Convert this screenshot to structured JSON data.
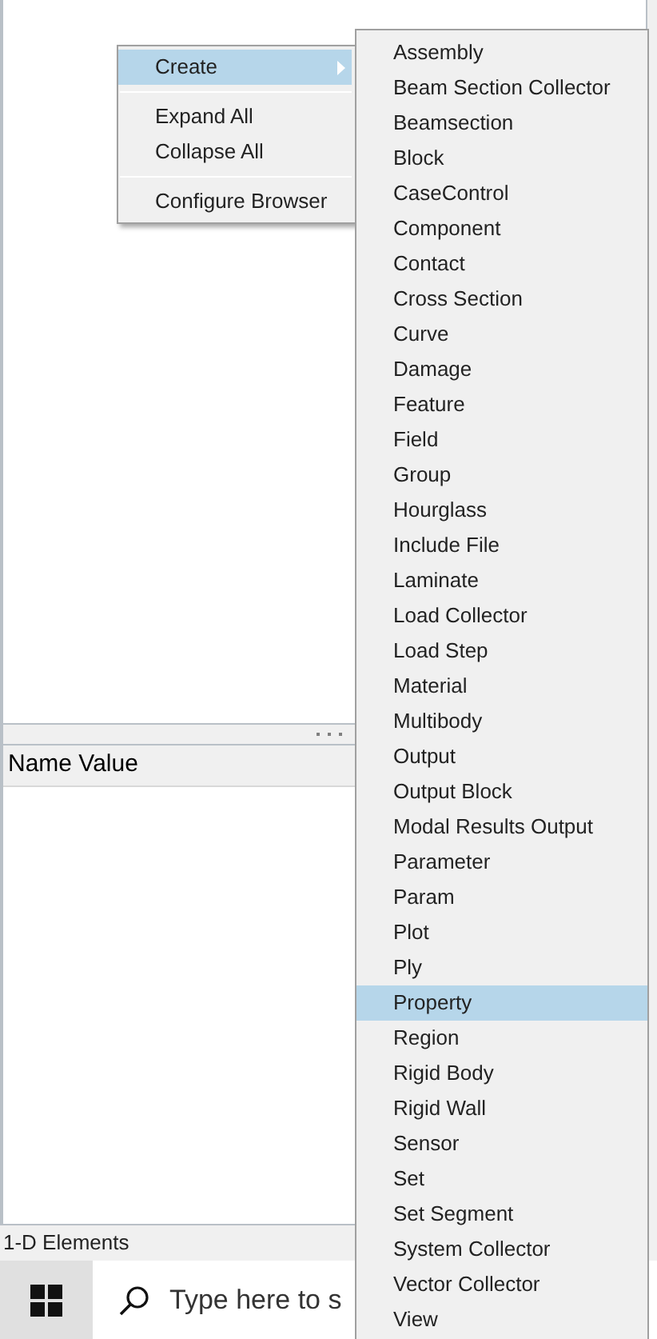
{
  "browser": {
    "properties_header": "Name Value"
  },
  "context_menu": {
    "items": [
      {
        "kind": "item",
        "label": "Create",
        "selected": true,
        "submenu": true
      },
      {
        "kind": "separator"
      },
      {
        "kind": "item",
        "label": "Expand All",
        "selected": false,
        "submenu": false
      },
      {
        "kind": "item",
        "label": "Collapse All",
        "selected": false,
        "submenu": false
      },
      {
        "kind": "separator"
      },
      {
        "kind": "item",
        "label": "Configure Browser",
        "selected": false,
        "submenu": false
      }
    ]
  },
  "submenu": {
    "items": [
      {
        "label": "Assembly",
        "selected": false
      },
      {
        "label": "Beam Section Collector",
        "selected": false
      },
      {
        "label": "Beamsection",
        "selected": false
      },
      {
        "label": "Block",
        "selected": false
      },
      {
        "label": "CaseControl",
        "selected": false
      },
      {
        "label": "Component",
        "selected": false
      },
      {
        "label": "Contact",
        "selected": false
      },
      {
        "label": "Cross Section",
        "selected": false
      },
      {
        "label": "Curve",
        "selected": false
      },
      {
        "label": "Damage",
        "selected": false
      },
      {
        "label": "Feature",
        "selected": false
      },
      {
        "label": "Field",
        "selected": false
      },
      {
        "label": "Group",
        "selected": false
      },
      {
        "label": "Hourglass",
        "selected": false
      },
      {
        "label": "Include File",
        "selected": false
      },
      {
        "label": "Laminate",
        "selected": false
      },
      {
        "label": "Load Collector",
        "selected": false
      },
      {
        "label": "Load Step",
        "selected": false
      },
      {
        "label": "Material",
        "selected": false
      },
      {
        "label": "Multibody",
        "selected": false
      },
      {
        "label": "Output",
        "selected": false
      },
      {
        "label": "Output Block",
        "selected": false
      },
      {
        "label": "Modal Results Output",
        "selected": false
      },
      {
        "label": "Parameter",
        "selected": false
      },
      {
        "label": "Param",
        "selected": false
      },
      {
        "label": "Plot",
        "selected": false
      },
      {
        "label": "Ply",
        "selected": false
      },
      {
        "label": "Property",
        "selected": true
      },
      {
        "label": "Region",
        "selected": false
      },
      {
        "label": "Rigid Body",
        "selected": false
      },
      {
        "label": "Rigid Wall",
        "selected": false
      },
      {
        "label": "Sensor",
        "selected": false
      },
      {
        "label": "Set",
        "selected": false
      },
      {
        "label": "Set Segment",
        "selected": false
      },
      {
        "label": "System Collector",
        "selected": false
      },
      {
        "label": "Vector Collector",
        "selected": false
      },
      {
        "label": "View",
        "selected": false
      }
    ]
  },
  "status_bar": {
    "text": "1-D Elements"
  },
  "taskbar": {
    "search_placeholder": "Type here to s"
  }
}
